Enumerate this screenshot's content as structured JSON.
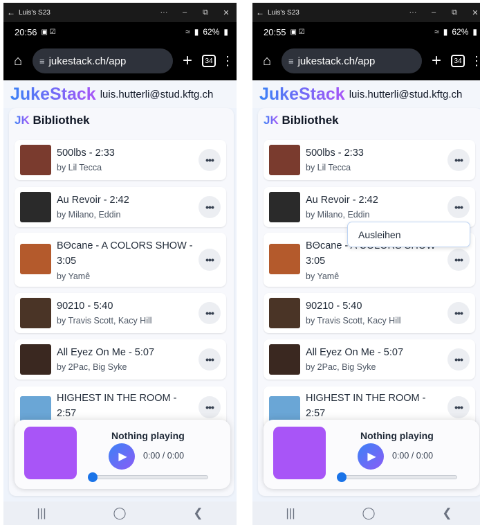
{
  "window": {
    "title": "Luis's S23",
    "controls": [
      "···",
      "–",
      "⧉",
      "✕"
    ]
  },
  "screens": [
    {
      "status_time": "20:56",
      "popup_visible": false
    },
    {
      "status_time": "20:55",
      "popup_visible": true
    }
  ],
  "status": {
    "battery": "62%",
    "signal_text": "↯ ⁘ .∣"
  },
  "browser": {
    "url": "jukestack.ch/app",
    "tab_count": "34"
  },
  "header": {
    "brand": "JukeStack",
    "email": "luis.hutterli@stud.kftg.ch"
  },
  "library": {
    "title_prefix": "JK",
    "title": "Bibliothek",
    "songs": [
      {
        "title": "500lbs - 2:33",
        "artist": "by Lil Tecca",
        "cover": "#7a3b2e"
      },
      {
        "title": "Au Revoir - 2:42",
        "artist": "by Milano, Eddin",
        "cover": "#2a2a2a"
      },
      {
        "title": "BΘcane - A COLORS SHOW - 3:05",
        "artist": "by Yamê",
        "cover": "#b45a2c"
      },
      {
        "title": "90210 - 5:40",
        "artist": "by Travis Scott, Kacy Hill",
        "cover": "#4a3426"
      },
      {
        "title": "All Eyez On Me - 5:07",
        "artist": "by 2Pac, Big Syke",
        "cover": "#3a2820"
      },
      {
        "title": "HIGHEST IN THE ROOM - 2:57",
        "artist": "",
        "cover": "#6aa6d6"
      }
    ],
    "more_label": "•••"
  },
  "popup": {
    "item": "Ausleihen"
  },
  "player": {
    "status": "Nothing playing",
    "time": "0:00 / 0:00",
    "progress": 0
  },
  "nav": {
    "recents": "|||",
    "home": "◯",
    "back": "❮"
  }
}
